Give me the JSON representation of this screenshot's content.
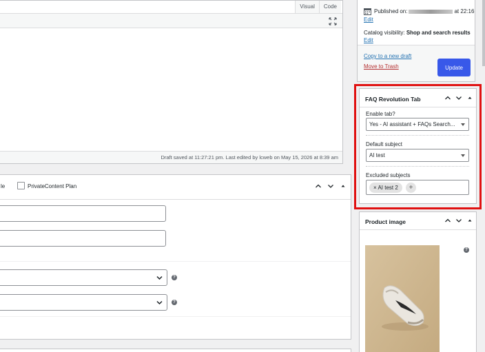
{
  "editor": {
    "tabs": [
      "Visual",
      "Code"
    ],
    "status": "Draft saved at 11:27:21 pm. Last edited by lcweb on May 15, 2026 at 8:39 am"
  },
  "product_data": {
    "header_partial": "le",
    "privatecontent_label": "PrivateContent Plan"
  },
  "publish": {
    "published_label": "Published on:",
    "published_time": "at 22:16",
    "edit_1": "Edit",
    "visibility_label": "Catalog visibility:",
    "visibility_value": "Shop and search results",
    "edit_2": "Edit",
    "copy_link": "Copy to a new draft",
    "trash_link": "Move to Trash",
    "update_button": "Update"
  },
  "faq": {
    "title": "FAQ Revolution Tab",
    "enable_label": "Enable tab?",
    "enable_value": "Yes - AI assistant + FAQs Search...",
    "subject_label": "Default subject",
    "subject_value": "AI test",
    "excluded_label": "Excluded subjects",
    "excluded_tag": "× AI test 2",
    "add_tag": "+"
  },
  "product_image": {
    "title": "Product image"
  },
  "colors": {
    "accent": "#3858e9",
    "highlight": "#e01010",
    "link": "#2271b1",
    "danger": "#b32d2e"
  }
}
